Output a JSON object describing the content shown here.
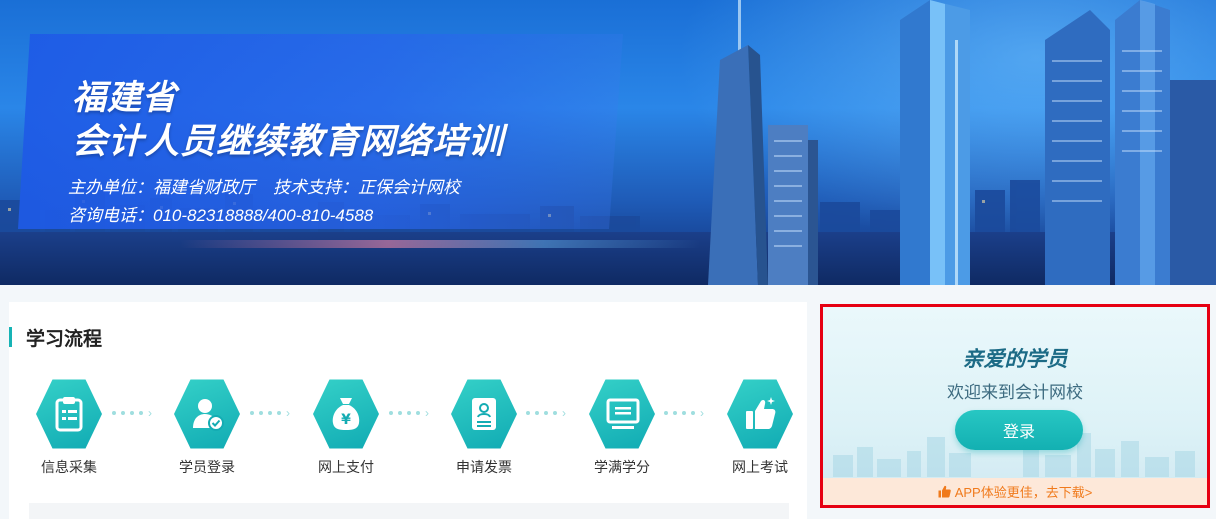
{
  "banner": {
    "title_line1": "福建省",
    "title_line2": "会计人员继续教育网络培训",
    "organizer": "主办单位：福建省财政厅",
    "tech_support": "技术支持：正保会计网校",
    "hotline": "咨询电话：010-82318888/400-810-4588"
  },
  "process": {
    "title": "学习流程",
    "steps": [
      {
        "label": "信息采集",
        "icon": "clipboard-icon"
      },
      {
        "label": "学员登录",
        "icon": "user-check-icon"
      },
      {
        "label": "网上支付",
        "icon": "money-bag-icon"
      },
      {
        "label": "申请发票",
        "icon": "invoice-icon"
      },
      {
        "label": "学满学分",
        "icon": "monitor-icon"
      },
      {
        "label": "网上考试",
        "icon": "thumbs-up-icon"
      }
    ]
  },
  "login": {
    "greeting": "亲爱的学员",
    "welcome": "欢迎来到会计网校",
    "button": "登录",
    "app_promo": "APP体验更佳，去下载>"
  },
  "colors": {
    "accent": "#13b0b2",
    "highlight_border": "#e60012",
    "promo_text": "#f07a1c"
  }
}
